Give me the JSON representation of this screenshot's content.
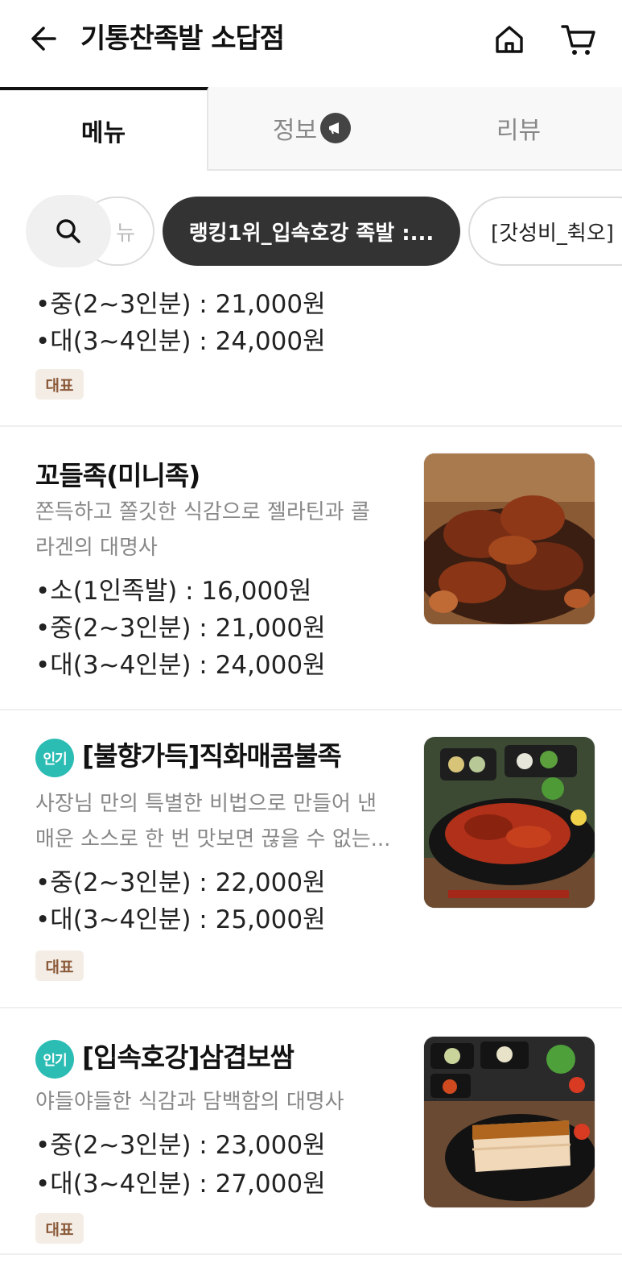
{
  "header": {
    "title": "기통찬족발 소답점"
  },
  "tabs": [
    {
      "label": "메뉴"
    },
    {
      "label": "정보"
    },
    {
      "label": "리뷰"
    }
  ],
  "chips": {
    "partial_label": "뉴",
    "active_label": "랭킹1위_입속호강 족발 :...",
    "next_label": "[갓성비_췩오]"
  },
  "menu_items": [
    {
      "prices": [
        "•중(2~3인분) : 21,000원",
        "•대(3~4인분) : 24,000원"
      ],
      "tag": "대표"
    },
    {
      "name": "꼬들족(미니족)",
      "desc1": "쫀득하고 쫄깃한 식감으로 젤라틴과 콜",
      "desc2": "라겐의 대명사",
      "prices": [
        "•소(1인족발) : 16,000원",
        "•중(2~3인분) : 21,000원",
        "•대(3~4인분) : 24,000원"
      ]
    },
    {
      "badge": "인기",
      "name": "[불향가득]직화매콤불족",
      "desc1": "사장님 만의 특별한 비법으로 만들어 낸",
      "desc2": "매운 소스로 한 번 맛보면 끊을 수 없는...",
      "prices": [
        "•중(2~3인분) : 22,000원",
        "•대(3~4인분) : 25,000원"
      ],
      "tag": "대표"
    },
    {
      "badge": "인기",
      "name": "[입속호강]삼겹보쌈",
      "desc1": "야들야들한 식감과 담백함의 대명사",
      "prices": [
        "•중(2~3인분) : 23,000원",
        "•대(3~4인분) : 27,000원"
      ],
      "tag": "대표"
    }
  ]
}
